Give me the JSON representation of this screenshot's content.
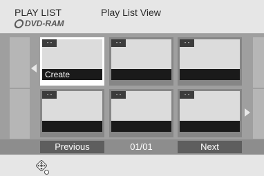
{
  "header": {
    "title": "PLAY LIST",
    "view_title": "Play List View",
    "media": "DVD-RAM",
    "media_icon": "disc-icon"
  },
  "grid": {
    "tiles": [
      {
        "tag": "- -",
        "label": "Create",
        "selected": true
      },
      {
        "tag": "- -",
        "label": "",
        "selected": false
      },
      {
        "tag": "- -",
        "label": "",
        "selected": false
      },
      {
        "tag": "- -",
        "label": "",
        "selected": false
      },
      {
        "tag": "- -",
        "label": "",
        "selected": false
      },
      {
        "tag": "- -",
        "label": "",
        "selected": false
      }
    ],
    "left_arrow_icon": "chevron-left-icon",
    "right_arrow_icon": "chevron-right-icon"
  },
  "footer": {
    "previous_label": "Previous",
    "page": "01/01",
    "next_label": "Next"
  },
  "hint": {
    "icon": "dpad-icon"
  },
  "colors": {
    "header_bg": "#e6e6e6",
    "content_bg": "#9f9f9f",
    "tile_bg": "#868686",
    "selected_tile_bg": "#ffffff",
    "label_bar": "#1a1a1a",
    "button_bg": "#5e5e5e"
  }
}
